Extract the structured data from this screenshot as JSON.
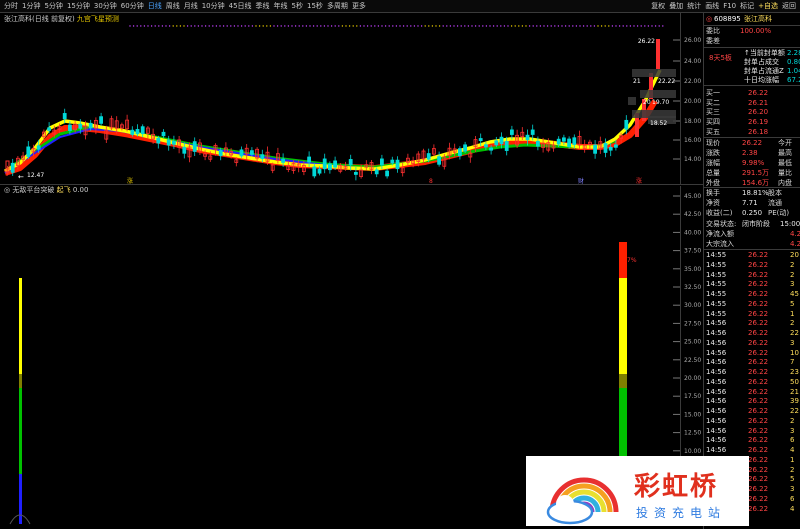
{
  "toolbar": {
    "periods": [
      "分时",
      "1分钟",
      "5分钟",
      "15分钟",
      "30分钟",
      "60分钟",
      "日线",
      "周线",
      "月线",
      "10分钟",
      "45日线",
      "季线",
      "年线",
      "5秒",
      "15秒",
      "多周期",
      "更多"
    ],
    "active_index": 6,
    "tools": [
      "复权",
      "叠加",
      "统计",
      "画线",
      "F10",
      "标记",
      "+自选",
      "返回"
    ]
  },
  "chart_title": {
    "stock": "张江高科(日线 前复权)",
    "indicator": "九宫飞星预测"
  },
  "price_axis": [
    "26.00",
    "24.00",
    "22.00",
    "20.00",
    "18.00",
    "16.00",
    "14.00"
  ],
  "price_annotations": {
    "high": "26.22",
    "low": "12.47",
    "mid1": "21",
    "mid2": "22.22",
    "mid3": "20",
    "mid4": "18.52",
    "mid5": "19.70"
  },
  "chart_marks": [
    "涨",
    "8",
    "财",
    "涨"
  ],
  "ind2_title": {
    "name": "无敌平台突破",
    "label": "起飞",
    "value": "0.00"
  },
  "ind2_axis": [
    "45.00",
    "42.50",
    "40.00",
    "37.50",
    "35.00",
    "32.50",
    "30.00",
    "27.50",
    "25.00",
    "22.50",
    "20.00",
    "17.50",
    "15.00",
    "12.50",
    "10.00",
    "7.50",
    "5.00",
    "2.50"
  ],
  "ind2_mark": "7%",
  "side": {
    "code": "608895",
    "name": "张江高科",
    "weibi_label": "委比",
    "weibi_value": "100.00%",
    "weicha_label": "委差",
    "tags": [
      "↑当前封单额",
      "封单占成交",
      "封单占流通Z",
      "十日均涨幅"
    ],
    "tag_values": [
      "2.28",
      "0.80",
      "1.04",
      "67.22"
    ],
    "streak": "8天5板",
    "bids": [
      {
        "label": "买一",
        "price": "26.22"
      },
      {
        "label": "买二",
        "price": "26.21"
      },
      {
        "label": "买三",
        "price": "26.20"
      },
      {
        "label": "买四",
        "price": "26.19"
      },
      {
        "label": "买五",
        "price": "26.18"
      }
    ],
    "stats": [
      {
        "l1": "现价",
        "v1": "26.22",
        "l2": "今开"
      },
      {
        "l1": "涨跌",
        "v1": "2.38",
        "l2": "最高"
      },
      {
        "l1": "涨幅",
        "v1": "9.98%",
        "l2": "最低"
      },
      {
        "l1": "总量",
        "v1": "291.5万",
        "l2": "量比"
      },
      {
        "l1": "外盘",
        "v1": "154.6万",
        "l2": "内盘"
      }
    ],
    "stats2": [
      {
        "l1": "换手",
        "v1": "18.81%",
        "l2": "股本"
      },
      {
        "l1": "净资",
        "v1": "7.71",
        "l2": "流通"
      },
      {
        "l1": "收益(二)",
        "v1": "0.250",
        "l2": "PE(动)"
      }
    ],
    "status_label": "交易状态:",
    "status_value": "闭市阶段",
    "status_time": "15:00",
    "flows": [
      {
        "label": "净流入额",
        "value": "4.2"
      },
      {
        "label": "大宗流入",
        "value": "4.2"
      }
    ],
    "trades": [
      {
        "t": "14:55",
        "p": "26.22",
        "q": "20"
      },
      {
        "t": "14:55",
        "p": "26.22",
        "q": "2"
      },
      {
        "t": "14:55",
        "p": "26.22",
        "q": "2"
      },
      {
        "t": "14:55",
        "p": "26.22",
        "q": "3"
      },
      {
        "t": "14:55",
        "p": "26.22",
        "q": "45"
      },
      {
        "t": "14:55",
        "p": "26.22",
        "q": "5"
      },
      {
        "t": "14:55",
        "p": "26.22",
        "q": "1"
      },
      {
        "t": "14:56",
        "p": "26.22",
        "q": "2"
      },
      {
        "t": "14:56",
        "p": "26.22",
        "q": "22"
      },
      {
        "t": "14:56",
        "p": "26.22",
        "q": "3"
      },
      {
        "t": "14:56",
        "p": "26.22",
        "q": "10"
      },
      {
        "t": "14:56",
        "p": "26.22",
        "q": "7"
      },
      {
        "t": "14:56",
        "p": "26.22",
        "q": "23"
      },
      {
        "t": "14:56",
        "p": "26.22",
        "q": "50"
      },
      {
        "t": "14:56",
        "p": "26.22",
        "q": "21"
      },
      {
        "t": "14:56",
        "p": "26.22",
        "q": "39"
      },
      {
        "t": "14:56",
        "p": "26.22",
        "q": "22"
      },
      {
        "t": "14:56",
        "p": "26.22",
        "q": "2"
      },
      {
        "t": "14:56",
        "p": "26.22",
        "q": "3"
      },
      {
        "t": "14:56",
        "p": "26.22",
        "q": "6"
      },
      {
        "t": "14:56",
        "p": "26.22",
        "q": "4"
      },
      {
        "t": "14:56",
        "p": "26.22",
        "q": "1"
      },
      {
        "t": "14:56",
        "p": "26.22",
        "q": "2"
      },
      {
        "t": "14:56",
        "p": "26.22",
        "q": "5"
      },
      {
        "t": "14:56",
        "p": "26.22",
        "q": "3"
      },
      {
        "t": "14:57",
        "p": "26.22",
        "q": "6"
      },
      {
        "t": "14:57",
        "p": "26.22",
        "q": "4"
      }
    ]
  },
  "logo": {
    "title": "彩虹桥",
    "subtitle": "投资充电站"
  },
  "colors": {
    "bg": "#000000",
    "up": "#ff3030",
    "down": "#00d8d8",
    "ma_yellow": "#ffff00",
    "ma_red": "#ff2000",
    "ma_green": "#00c000",
    "ma_blue": "#2020ff"
  }
}
